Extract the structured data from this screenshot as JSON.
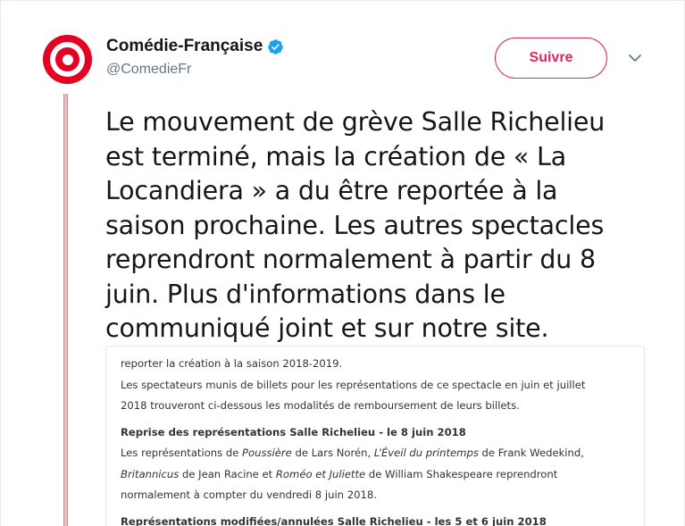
{
  "account": {
    "display_name": "Comédie-Française",
    "handle": "@ComedieFr",
    "verified": true
  },
  "actions": {
    "follow_label": "Suivre",
    "menu_icon": "chevron-down-icon"
  },
  "tweet": {
    "lines": [
      "Le mouvement de grève Salle Richelieu",
      "est terminé, mais la création de « La",
      "Locandiera » a du être reportée à la",
      "saison prochaine. Les autres spectacles",
      "reprendront normalement à partir du 8",
      "juin. Plus d'informations dans le",
      "communiqué joint et sur notre site."
    ]
  },
  "document": {
    "line1": "reporter la création à la saison 2018-2019.",
    "para2_line1": "Les spectateurs munis de billets pour les représentations de ce spectacle en juin et juillet",
    "para2_line2": "2018 trouveront ci-dessous les modalités de remboursement de leurs billets.",
    "heading1": "Reprise des représentations Salle Richelieu - le 8 juin 2018",
    "p3_a": "Les représentations de ",
    "p3_b": "Poussière",
    "p3_c": " de Lars Norén, ",
    "p3_d": "L’Éveil du printemps",
    "p3_e": " de Frank Wedekind,",
    "p3_f": "Britannicus",
    "p3_g": " de Jean Racine et ",
    "p3_h": "Roméo et Juliette",
    "p3_i": " de William Shakespeare reprendront",
    "p3_line3": "normalement à compter du vendredi 8 juin 2018.",
    "heading2": "Représentations modifiées/annulées Salle Richelieu - les 5 et 6 juin 2018"
  },
  "colors": {
    "brand_red": "#e50024",
    "follow_pink": "#e0245e",
    "verified_blue": "#1da1f2",
    "secondary_text": "#657786"
  }
}
